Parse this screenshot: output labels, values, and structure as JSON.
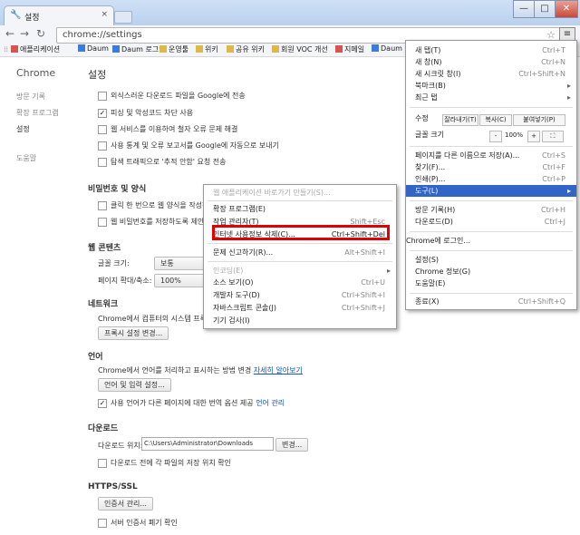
{
  "tab": {
    "title": "설정",
    "close": "×"
  },
  "window": {
    "minimize": "—",
    "maximize": "□",
    "close": "✕"
  },
  "toolbar": {
    "url": "chrome://settings"
  },
  "bookmarks": [
    {
      "label": "애플리케이션",
      "color": "#d9534f"
    },
    {
      "label": "Daum",
      "color": "#3b7ddd"
    },
    {
      "label": "Daum 로그인",
      "color": "#3b7ddd"
    },
    {
      "label": "운영툴",
      "color": "#e0b84a"
    },
    {
      "label": "위키",
      "color": "#e0b84a"
    },
    {
      "label": "공유 위키",
      "color": "#e0b84a"
    },
    {
      "label": "회원 VOC 개선",
      "color": "#e0b84a"
    },
    {
      "label": "지메일",
      "color": "#d9534f"
    },
    {
      "label": "Daum",
      "color": "#3b7ddd"
    }
  ],
  "sidebar": {
    "title": "Chrome",
    "items": [
      "방문 기록",
      "확장 프로그램",
      "설정",
      "도움말"
    ]
  },
  "settings": {
    "title": "설정",
    "privacy_checks": [
      {
        "label": "외식스러운 다운로드 파일을 Google에 전송",
        "checked": false
      },
      {
        "label": "피싱 및 악성코드 차단 사용",
        "checked": true
      },
      {
        "label": "웹 서비스를 이용하여 철자 오류 문제 해결",
        "checked": false
      },
      {
        "label": "사용 통계 및 오류 보고서를 Google에 자동으로 보내기",
        "checked": false
      },
      {
        "label": "탐색 트래픽으로 '추적 안함' 요청 전송",
        "checked": false
      }
    ],
    "passwords_title": "비밀번호 및 양식",
    "passwords_checks": [
      {
        "label": "클릭 한 번으로 웹 양식을 작성하",
        "checked": false
      },
      {
        "label": "웹 비밀번호를 저장하도록 제안",
        "checked": false
      }
    ],
    "webcontent_title": "웹 콘텐츠",
    "font_size_label": "글꼴 크기:",
    "font_size_value": "보통",
    "zoom_label": "페이지 확대/축소:",
    "zoom_value": "100%",
    "network_title": "네트워크",
    "network_desc": "Chrome에서 컴퓨터의 시스템 프록시",
    "proxy_button": "프록시 설정 변경...",
    "language_title": "언어",
    "language_desc": "Chrome에서 언어를 처리하고 표시하는 방법 변경",
    "language_link": "자세히 알아보기",
    "language_button": "언어 및 입력 설정...",
    "translate_check": {
      "label": "사용 언어가 다른 페이지에 대한 번역 옵션 제공",
      "checked": true
    },
    "translate_link": "언어 관리",
    "download_title": "다운로드",
    "download_label": "다운로드 위치:",
    "download_path": "C:\\Users\\Administrator\\Downloads",
    "download_change": "변경...",
    "download_ask": {
      "label": "다운로드 전에 각 파일의 저장 위치 확인",
      "checked": false
    },
    "https_title": "HTTPS/SSL",
    "cert_button": "인증서 관리...",
    "cert_check": {
      "label": "서버 인증서 폐기 확인",
      "checked": false
    }
  },
  "main_menu": {
    "items": [
      {
        "label": "새 탭(T)",
        "shortcut": "Ctrl+T"
      },
      {
        "label": "새 창(N)",
        "shortcut": "Ctrl+N"
      },
      {
        "label": "새 시크릿 창(I)",
        "shortcut": "Ctrl+Shift+N"
      },
      {
        "label": "북마크(B)",
        "shortcut": ""
      },
      {
        "label": "최근 탭",
        "shortcut": ""
      }
    ],
    "edit_label": "수정",
    "cut": "잘라내기(T)",
    "copy": "복사(C)",
    "paste": "붙여넣기(P)",
    "zoom_label": "글꼴 크기",
    "zoom_minus": "-",
    "zoom_value": "100%",
    "zoom_plus": "+",
    "items2": [
      {
        "label": "페이지를 다른 이름으로 저장(A)...",
        "shortcut": "Ctrl+S"
      },
      {
        "label": "찾기(F)...",
        "shortcut": "Ctrl+F"
      },
      {
        "label": "인쇄(P)...",
        "shortcut": "Ctrl+P"
      },
      {
        "label": "도구(L)",
        "shortcut": ""
      }
    ],
    "items3": [
      {
        "label": "방문 기록(H)",
        "shortcut": "Ctrl+H"
      },
      {
        "label": "다운로드(D)",
        "shortcut": "Ctrl+J"
      }
    ],
    "signin": "Chrome에 로그인...",
    "items4": [
      {
        "label": "설정(S)",
        "shortcut": ""
      },
      {
        "label": "Chrome 정보(G)",
        "shortcut": ""
      },
      {
        "label": "도움말(E)",
        "shortcut": ""
      }
    ],
    "exit": {
      "label": "종료(X)",
      "shortcut": "Ctrl+Shift+Q"
    }
  },
  "tools_menu": {
    "items": [
      {
        "label": "웹 애플리케이션 바로가기 만들기(S)...",
        "shortcut": "",
        "disabled": true
      },
      {
        "label": "확장 프로그램(E)",
        "shortcut": ""
      },
      {
        "label": "작업 관리자(T)",
        "shortcut": "Shift+Esc"
      },
      {
        "label": "인터넷 사용정보 삭제(C)...",
        "shortcut": "Ctrl+Shift+Del"
      },
      {
        "label": "문제 신고하기(R)...",
        "shortcut": "Alt+Shift+I"
      },
      {
        "label": "인코딩(E)",
        "shortcut": "",
        "disabled": true
      },
      {
        "label": "소스 보기(O)",
        "shortcut": "Ctrl+U"
      },
      {
        "label": "개발자 도구(D)",
        "shortcut": "Ctrl+Shift+I"
      },
      {
        "label": "자바스크립트 콘솔(J)",
        "shortcut": "Ctrl+Shift+J"
      },
      {
        "label": "기기 검사(I)",
        "shortcut": ""
      }
    ]
  },
  "highlight_color": "#e00000",
  "accent_color": "#3166c8"
}
